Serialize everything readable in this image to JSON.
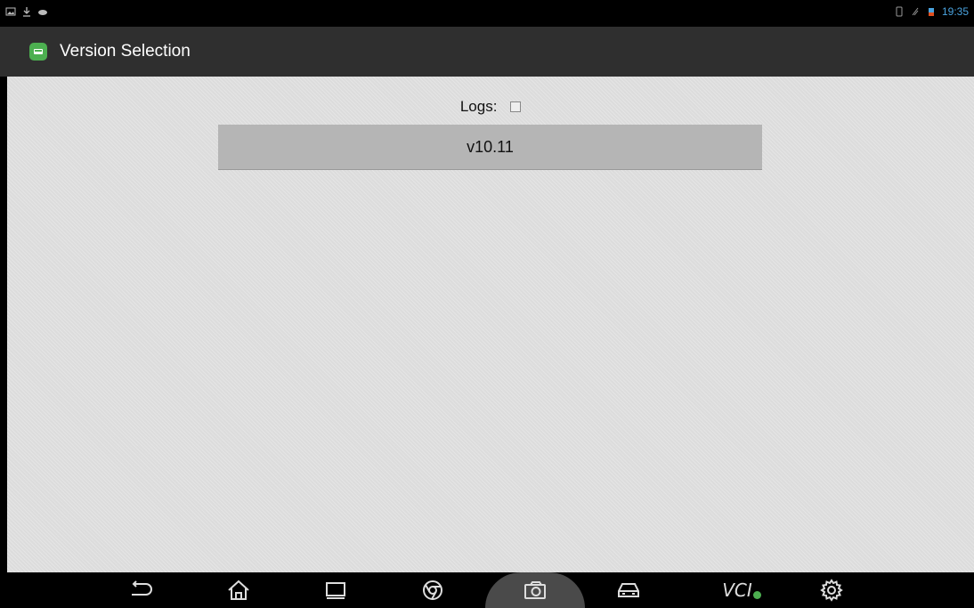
{
  "status_bar": {
    "left_icons": [
      "image-icon",
      "download-icon",
      "gamepad-icon"
    ],
    "right_icons": [
      "sim-icon",
      "signal-icon",
      "battery-icon"
    ],
    "time": "19:35"
  },
  "action_bar": {
    "app_icon": "car-app-icon",
    "title": "Version Selection"
  },
  "content": {
    "logs_label": "Logs:",
    "logs_checked": false,
    "versions": [
      "v10.11"
    ]
  },
  "nav_bar": {
    "buttons": [
      "back-icon",
      "home-icon",
      "recents-icon",
      "chrome-icon",
      "camera-icon",
      "car-icon",
      "vci-icon",
      "settings-icon"
    ],
    "vci_label": "VCI"
  },
  "colors": {
    "action_bar": "#2f2f2f",
    "content_bg": "#dcdcdc",
    "version_item_bg": "#b5b5b5",
    "app_icon": "#4caf50"
  }
}
